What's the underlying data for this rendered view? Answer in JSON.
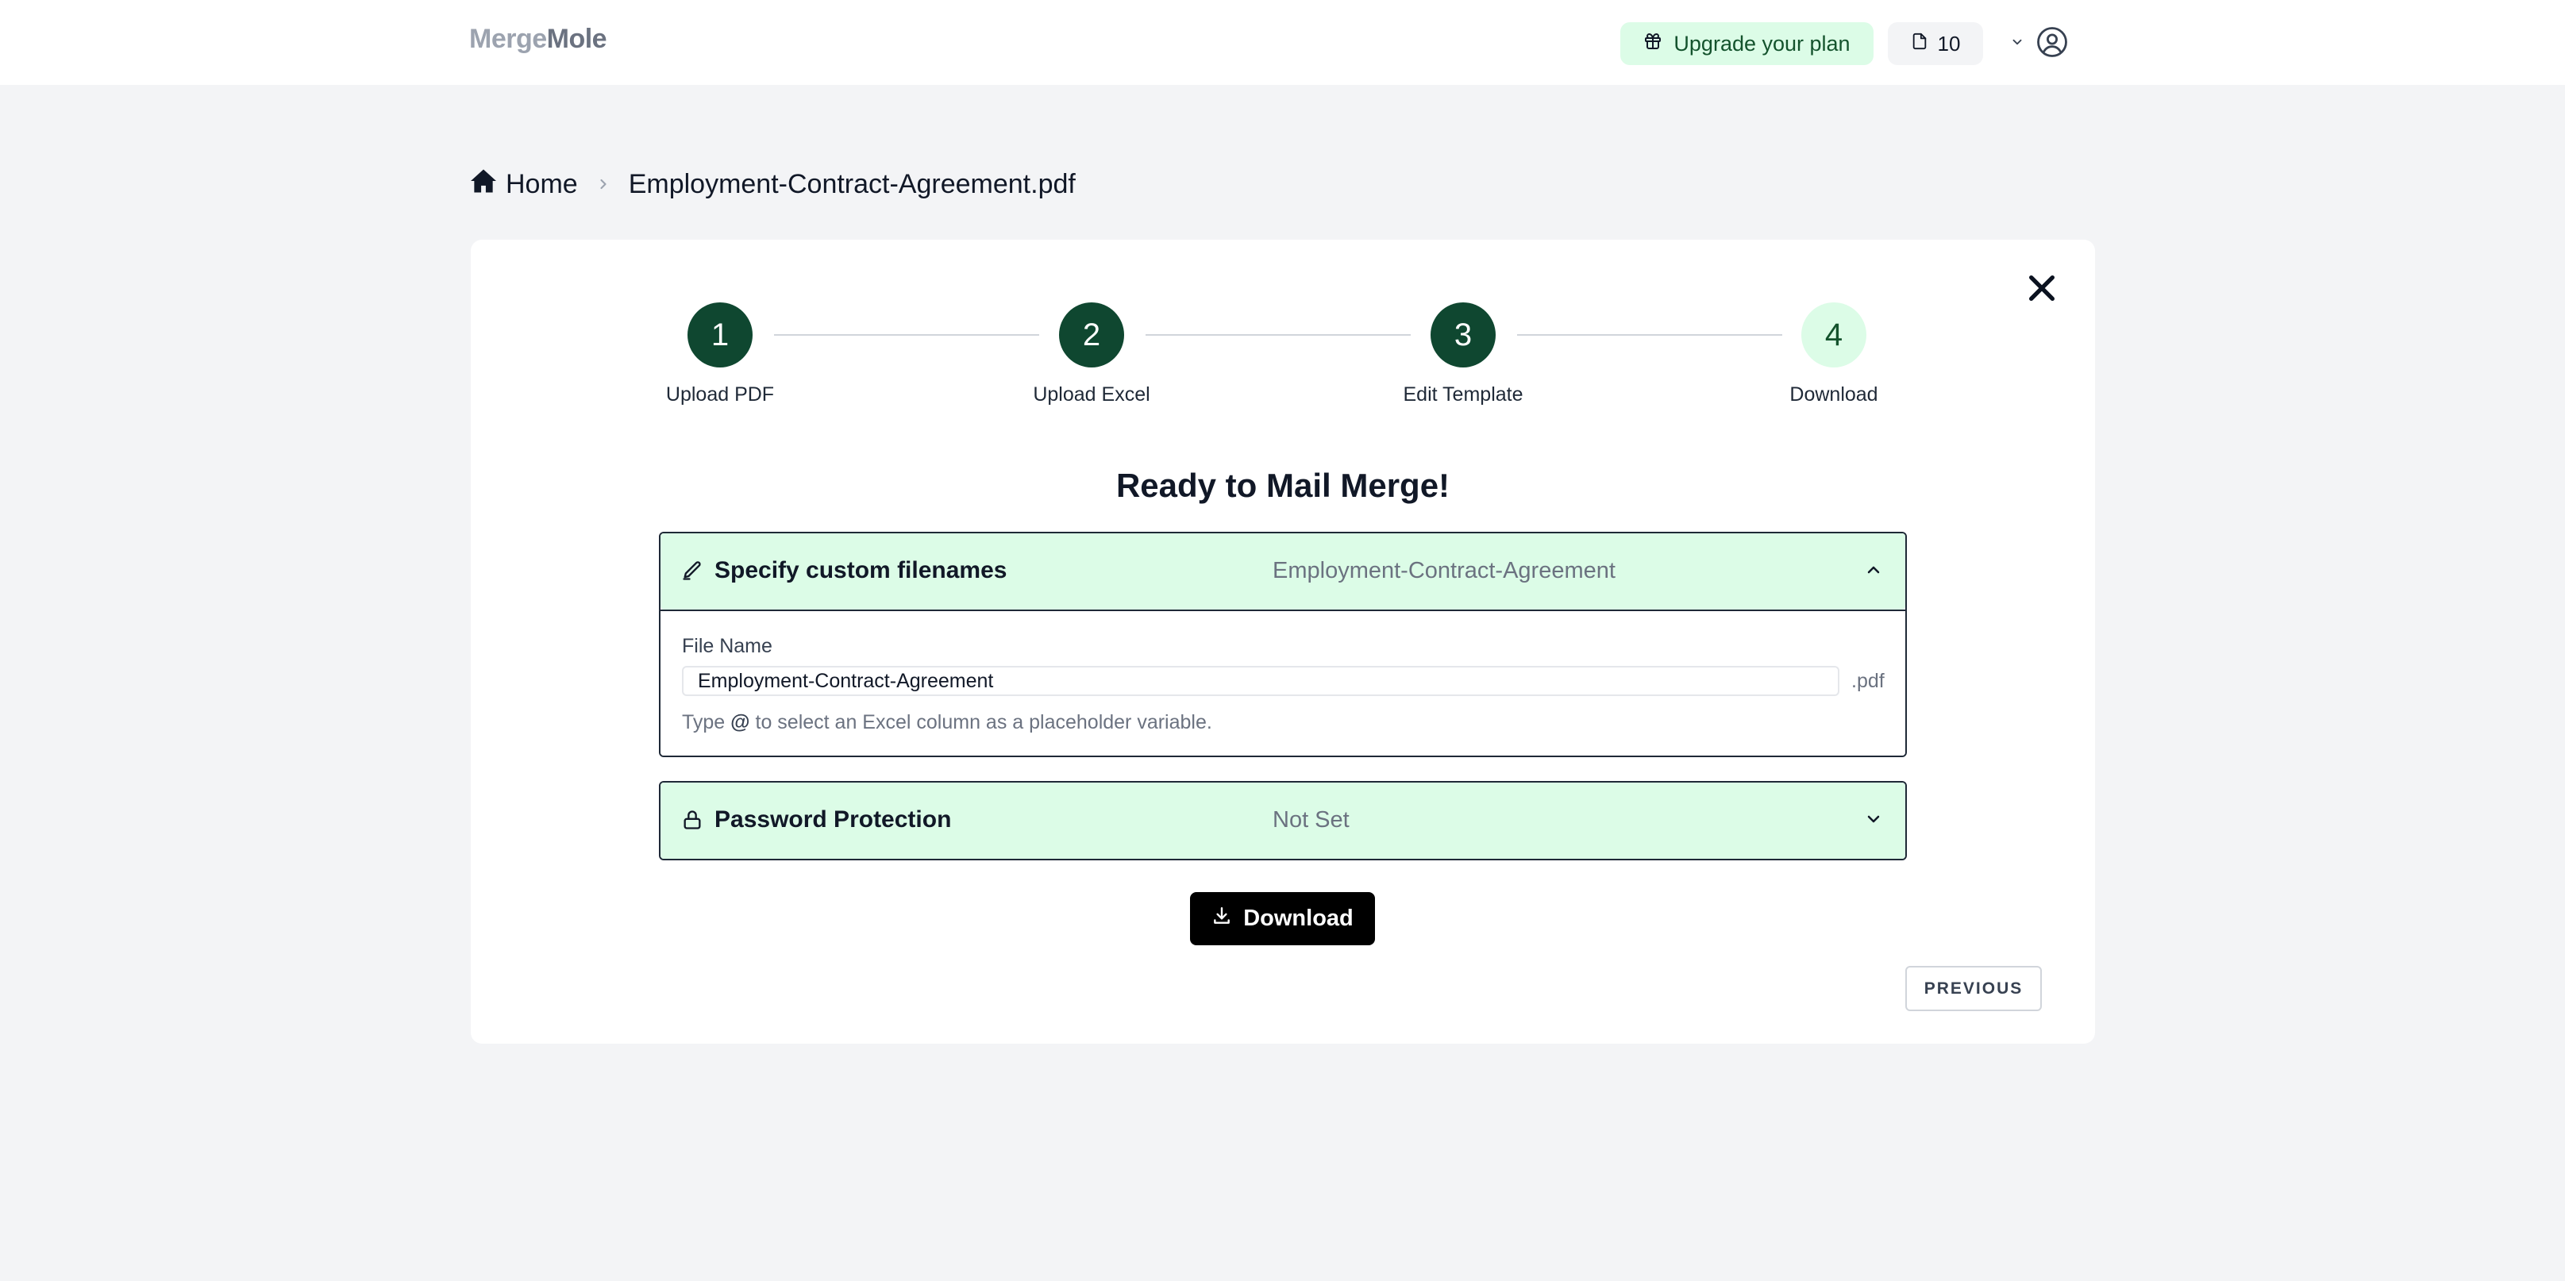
{
  "app": {
    "logo_part1": "Merge",
    "logo_part2": "Mole"
  },
  "header": {
    "upgrade_label": "Upgrade your plan",
    "credits": "10"
  },
  "breadcrumb": {
    "home": "Home",
    "current": "Employment-Contract-Agreement.pdf"
  },
  "stepper": {
    "steps": [
      {
        "number": "1",
        "label": "Upload PDF",
        "state": "complete"
      },
      {
        "number": "2",
        "label": "Upload Excel",
        "state": "complete"
      },
      {
        "number": "3",
        "label": "Edit Template",
        "state": "complete"
      },
      {
        "number": "4",
        "label": "Download",
        "state": "current"
      }
    ]
  },
  "main": {
    "heading": "Ready to Mail Merge!",
    "filenames_section": {
      "title": "Specify custom filenames",
      "value": "Employment-Contract-Agreement",
      "expanded": true,
      "field_label": "File Name",
      "input_value": "Employment-Contract-Agreement",
      "extension": ".pdf",
      "hint_prefix": "Type",
      "hint_at": "@",
      "hint_suffix": "to select an Excel column as a placeholder variable."
    },
    "password_section": {
      "title": "Password Protection",
      "value": "Not Set",
      "expanded": false
    },
    "download_label": "Download",
    "previous_label": "PREVIOUS"
  },
  "colors": {
    "step_complete": "#0f4730",
    "step_pending_bg": "#dcfce7",
    "accordion_bg": "#dcfce7",
    "download_bg": "#000000"
  }
}
